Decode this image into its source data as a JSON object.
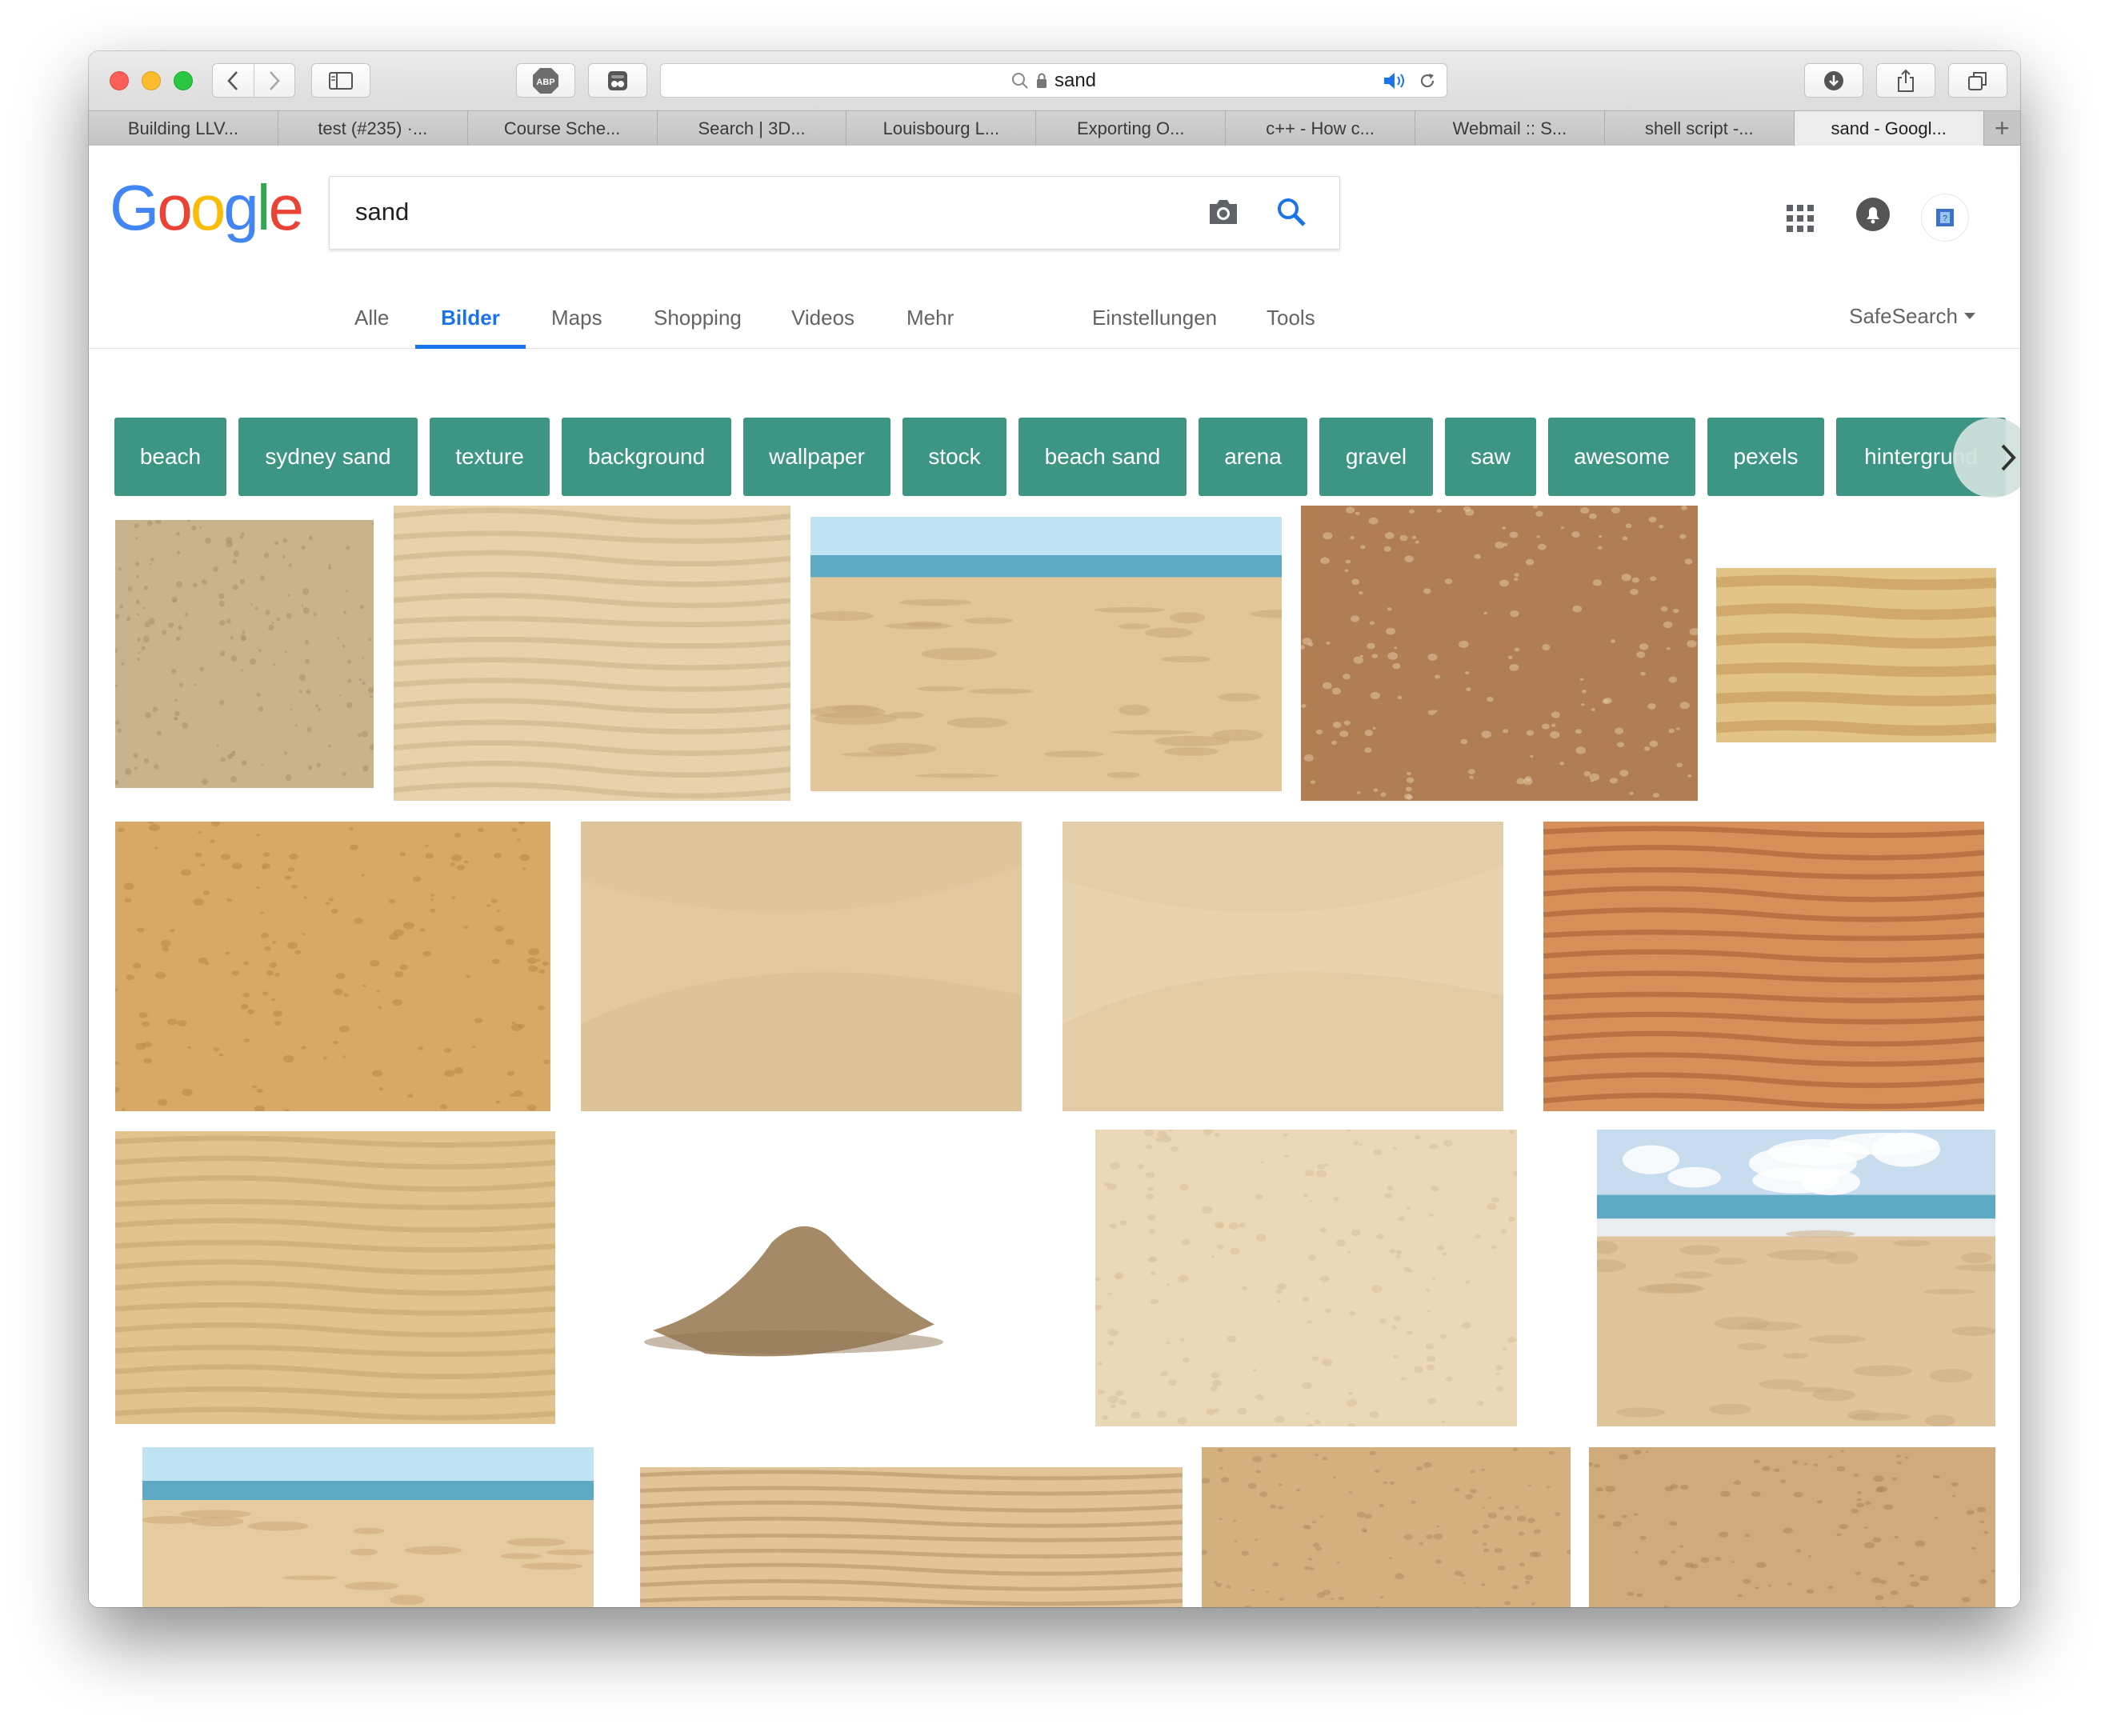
{
  "browser": {
    "url_text": "sand",
    "tabs": [
      "Building LLV...",
      "test (#235) ·...",
      "Course Sche...",
      "Search | 3D...",
      "Louisbourg L...",
      "Exporting O...",
      "c++ - How c...",
      "Webmail :: S...",
      "shell script -...",
      "sand - Googl..."
    ],
    "new_tab_glyph": "+",
    "adblock_label": "ABP"
  },
  "google": {
    "logo_letters": [
      "G",
      "o",
      "o",
      "g",
      "l",
      "e"
    ],
    "logo_colors": [
      "#4285f4",
      "#ea4335",
      "#fbbc05",
      "#4285f4",
      "#34a853",
      "#ea4335"
    ],
    "search_value": "sand",
    "nav": [
      "Alle",
      "Bilder",
      "Maps",
      "Shopping",
      "Videos",
      "Mehr",
      "Einstellungen",
      "Tools"
    ],
    "active_nav": "Bilder",
    "safesearch": "SafeSearch"
  },
  "chips": [
    "beach",
    "sydney sand",
    "texture",
    "background",
    "wallpaper",
    "stock",
    "beach sand",
    "arena",
    "gravel",
    "saw",
    "awesome",
    "pexels",
    "hintergrund"
  ],
  "colors": {
    "chip_bg": "#3d9584",
    "accent_blue": "#1a73e8"
  },
  "icons": {
    "camera": "camera-icon",
    "search": "search-icon",
    "apps": "apps-grid-icon",
    "notifications": "bell-icon",
    "avatar": "account-avatar"
  },
  "images": [
    {
      "kind": "texture",
      "base": "#c9b38c",
      "alt": "#a8906a"
    },
    {
      "kind": "ripples",
      "base": "#e6d2ad",
      "alt": "#cdb48b"
    },
    {
      "kind": "beach",
      "base": "#e2c599",
      "alt": "#c6a674"
    },
    {
      "kind": "texture",
      "base": "#b07e52",
      "alt": "#e2c7a0"
    },
    {
      "kind": "dunes",
      "base": "#e3c487",
      "alt": "#c59a59"
    },
    {
      "kind": "texture",
      "base": "#d8a966",
      "alt": "#b88842"
    },
    {
      "kind": "smooth",
      "base": "#e4c9a0",
      "alt": "#d4b68a"
    },
    {
      "kind": "smooth",
      "base": "#e8d3b0",
      "alt": "#d6bc93"
    },
    {
      "kind": "ripples",
      "base": "#d7905a",
      "alt": "#a85f32"
    },
    {
      "kind": "ripples",
      "base": "#e2c38e",
      "alt": "#c9a56d"
    },
    {
      "kind": "pile",
      "base": "#ffffff",
      "alt": "#a48a66"
    },
    {
      "kind": "texture",
      "base": "#ead8b7",
      "alt": "#d8c199"
    },
    {
      "kind": "beachsky",
      "base": "#e0c49c",
      "alt": "#c8a97c"
    },
    {
      "kind": "beach",
      "base": "#e6cba1",
      "alt": "#c9a673"
    },
    {
      "kind": "ripples",
      "base": "#e2c498",
      "alt": "#b99467"
    },
    {
      "kind": "texture",
      "base": "#d4b07e",
      "alt": "#b08c5c"
    },
    {
      "kind": "texture",
      "base": "#cfab7c",
      "alt": "#a9855a"
    }
  ]
}
